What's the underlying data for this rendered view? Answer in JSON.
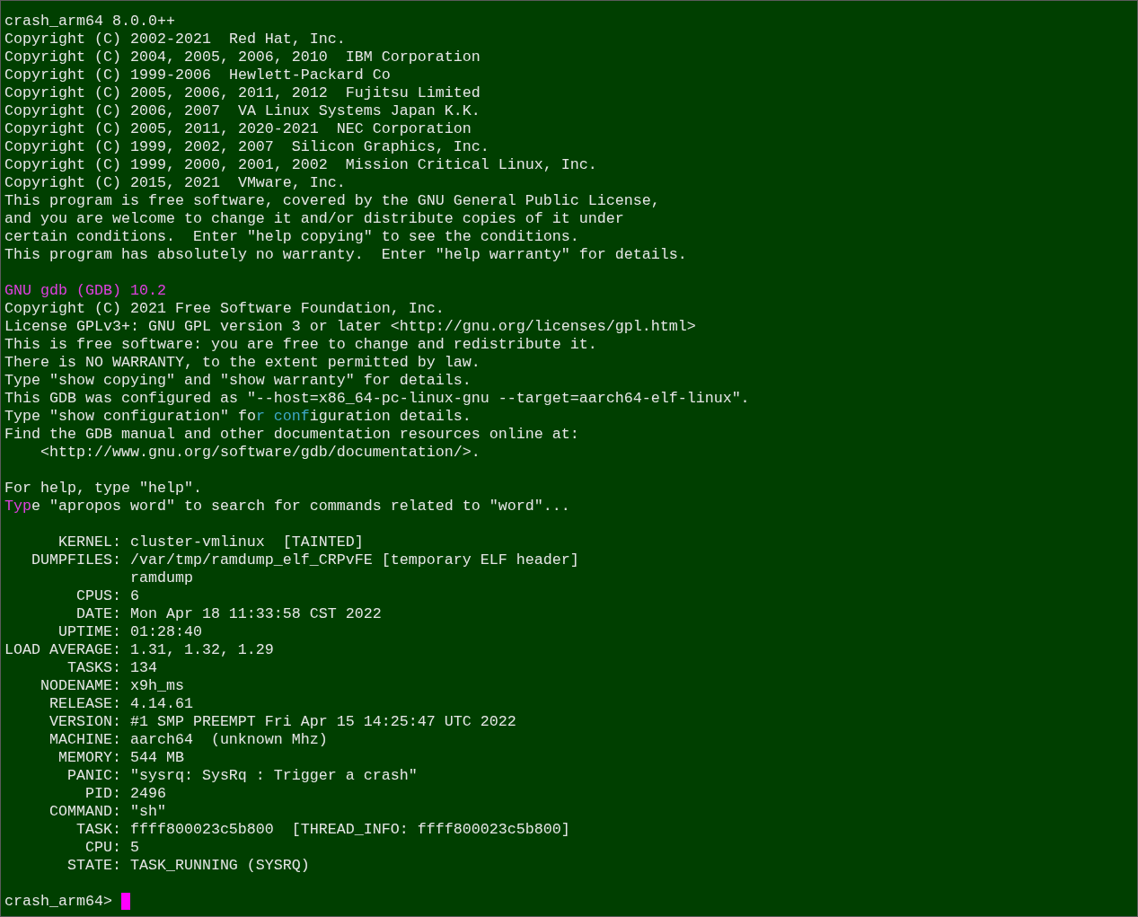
{
  "terminal": {
    "lines": [
      {
        "kind": "text",
        "segments": [
          {
            "text": "crash_arm64 8.0.0++"
          }
        ]
      },
      {
        "kind": "text",
        "segments": [
          {
            "text": "Copyright (C) 2002-2021  Red Hat, Inc."
          }
        ]
      },
      {
        "kind": "text",
        "segments": [
          {
            "text": "Copyright (C) 2004, 2005, 2006, 2010  IBM Corporation"
          }
        ]
      },
      {
        "kind": "text",
        "segments": [
          {
            "text": "Copyright (C) 1999-2006  Hewlett-Packard Co"
          }
        ]
      },
      {
        "kind": "text",
        "segments": [
          {
            "text": "Copyright (C) 2005, 2006, 2011, 2012  Fujitsu Limited"
          }
        ]
      },
      {
        "kind": "text",
        "segments": [
          {
            "text": "Copyright (C) 2006, 2007  VA Linux Systems Japan K.K."
          }
        ]
      },
      {
        "kind": "text",
        "segments": [
          {
            "text": "Copyright (C) 2005, 2011, 2020-2021  NEC Corporation"
          }
        ]
      },
      {
        "kind": "text",
        "segments": [
          {
            "text": "Copyright (C) 1999, 2002, 2007  Silicon Graphics, Inc."
          }
        ]
      },
      {
        "kind": "text",
        "segments": [
          {
            "text": "Copyright (C) 1999, 2000, 2001, 2002  Mission Critical Linux, Inc."
          }
        ]
      },
      {
        "kind": "text",
        "segments": [
          {
            "text": "Copyright (C) 2015, 2021  VMware, Inc."
          }
        ]
      },
      {
        "kind": "text",
        "segments": [
          {
            "text": "This program is free software, covered by the GNU General Public License,"
          }
        ]
      },
      {
        "kind": "text",
        "segments": [
          {
            "text": "and you are welcome to change it and/or distribute copies of it under"
          }
        ]
      },
      {
        "kind": "text",
        "segments": [
          {
            "text": "certain conditions.  Enter \"help copying\" to see the conditions."
          }
        ]
      },
      {
        "kind": "text",
        "segments": [
          {
            "text": "This program has absolutely no warranty.  Enter \"help warranty\" for details."
          }
        ]
      },
      {
        "kind": "blank"
      },
      {
        "kind": "text",
        "segments": [
          {
            "text": "GNU gdb (GDB) 10.2",
            "color": "#e040e0"
          }
        ]
      },
      {
        "kind": "text",
        "segments": [
          {
            "text": "Copyright (C) 2021 Free Software Foundation, Inc."
          }
        ]
      },
      {
        "kind": "text",
        "segments": [
          {
            "text": "License GPLv3+: GNU GPL version 3 or later <http://gnu.org/licenses/gpl.html>"
          }
        ]
      },
      {
        "kind": "text",
        "segments": [
          {
            "text": "This is free software: you are free to change and redistribute it."
          }
        ]
      },
      {
        "kind": "text",
        "segments": [
          {
            "text": "There is NO WARRANTY, to the extent permitted by law."
          }
        ]
      },
      {
        "kind": "text",
        "segments": [
          {
            "text": "Type \"show copying\" and \"show warranty\" for details."
          }
        ]
      },
      {
        "kind": "text",
        "segments": [
          {
            "text": "This GDB was configured as \"--host=x86_64-pc-linux-gnu --target=aarch64-elf-linux\"."
          }
        ]
      },
      {
        "kind": "text",
        "segments": [
          {
            "text": "Type \"show configuration\" fo"
          },
          {
            "text": "r conf",
            "color": "#3fa8c8"
          },
          {
            "text": "iguration details."
          }
        ]
      },
      {
        "kind": "text",
        "segments": [
          {
            "text": "Find the GDB manual and other documentation resources online at:"
          }
        ]
      },
      {
        "kind": "text",
        "segments": [
          {
            "text": "    <http://www.gnu.org/software/gdb/documentation/>."
          }
        ]
      },
      {
        "kind": "blank"
      },
      {
        "kind": "text",
        "segments": [
          {
            "text": "For help, type \"help\"."
          }
        ]
      },
      {
        "kind": "text",
        "segments": [
          {
            "text": "Typ",
            "color": "#e040e0"
          },
          {
            "text": "e \"apropos word\" to search for commands related to \"word\"..."
          }
        ]
      },
      {
        "kind": "blank"
      },
      {
        "kind": "field",
        "label": "KERNEL:",
        "value": "cluster-vmlinux  [TAINTED]"
      },
      {
        "kind": "field",
        "label": "DUMPFILES:",
        "value": "/var/tmp/ramdump_elf_CRPvFE [temporary ELF header]"
      },
      {
        "kind": "field",
        "value": "ramdump"
      },
      {
        "kind": "field",
        "label": "CPUS:",
        "value": "6"
      },
      {
        "kind": "field",
        "label": "DATE:",
        "value": "Mon Apr 18 11:33:58 CST 2022"
      },
      {
        "kind": "field",
        "label": "UPTIME:",
        "value": "01:28:40"
      },
      {
        "kind": "field",
        "label": "LOAD AVERAGE:",
        "value": "1.31, 1.32, 1.29"
      },
      {
        "kind": "field",
        "label": "TASKS:",
        "value": "134"
      },
      {
        "kind": "field",
        "label": "NODENAME:",
        "value": "x9h_ms"
      },
      {
        "kind": "field",
        "label": "RELEASE:",
        "value": "4.14.61"
      },
      {
        "kind": "field",
        "label": "VERSION:",
        "value": "#1 SMP PREEMPT Fri Apr 15 14:25:47 UTC 2022"
      },
      {
        "kind": "field",
        "label": "MACHINE:",
        "value": "aarch64  (unknown Mhz)"
      },
      {
        "kind": "field",
        "label": "MEMORY:",
        "value": "544 MB"
      },
      {
        "kind": "field",
        "label": "PANIC:",
        "value": "\"sysrq: SysRq : Trigger a crash\""
      },
      {
        "kind": "field",
        "label": "PID:",
        "value": "2496"
      },
      {
        "kind": "field",
        "label": "COMMAND:",
        "value": "\"sh\""
      },
      {
        "kind": "field",
        "label": "TASK:",
        "value": "ffff800023c5b800  [THREAD_INFO: ffff800023c5b800]"
      },
      {
        "kind": "field",
        "label": "CPU:",
        "value": "5"
      },
      {
        "kind": "field",
        "label": "STATE:",
        "value": "TASK_RUNNING (SYSRQ)"
      },
      {
        "kind": "blank"
      },
      {
        "kind": "prompt",
        "text": "crash_arm64>",
        "cursor": true
      }
    ]
  }
}
